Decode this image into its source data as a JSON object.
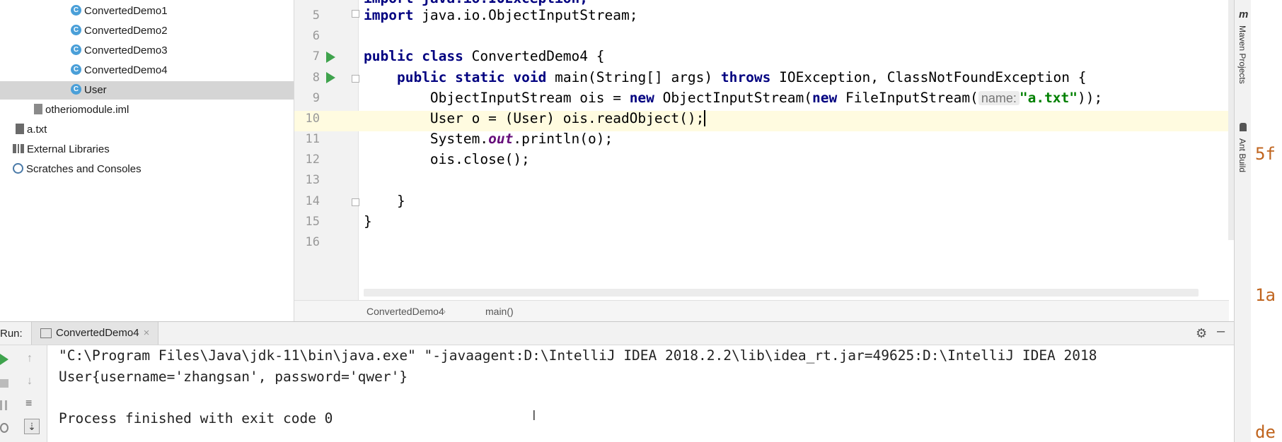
{
  "project_tree": {
    "items": [
      {
        "label": "ConvertedDemo1",
        "icon": "class-icon"
      },
      {
        "label": "ConvertedDemo2",
        "icon": "class-icon"
      },
      {
        "label": "ConvertedDemo3",
        "icon": "class-icon"
      },
      {
        "label": "ConvertedDemo4",
        "icon": "class-icon"
      },
      {
        "label": "User",
        "icon": "class-icon",
        "selected": true
      },
      {
        "label": "otheriomodule.iml",
        "icon": "iml-file-icon"
      },
      {
        "label": "a.txt",
        "icon": "text-file-icon"
      },
      {
        "label": "External Libraries",
        "icon": "library-icon"
      },
      {
        "label": "Scratches and Consoles",
        "icon": "scratch-icon"
      }
    ]
  },
  "editor": {
    "line_numbers": [
      "5",
      "6",
      "7",
      "8",
      "9",
      "10",
      "11",
      "12",
      "13",
      "14",
      "15",
      "16"
    ],
    "line4_partial": "import java.io.IOException;",
    "line5": {
      "kw": "import",
      "rest": " java.io.ObjectInputStream;"
    },
    "line7": {
      "kw1": "public",
      "kw2": "class",
      "rest": " ConvertedDemo4 {"
    },
    "line8": {
      "kw1": "public",
      "kw2": "static",
      "kw3": "void",
      "mid": " main(String[] args) ",
      "kw4": "throws",
      "rest": " IOException, ClassNotFoundException {"
    },
    "line9": {
      "a": "ObjectInputStream ois = ",
      "kw1": "new",
      "b": " ObjectInputStream(",
      "kw2": "new",
      "c": " FileInputStream(",
      "hint": "name:",
      "str": "\"a.txt\"",
      "d": "));"
    },
    "line10": "User o = (User) ois.readObject();",
    "line11": {
      "a": "System.",
      "field": "out",
      "b": ".println(o);"
    },
    "line12": "ois.close();",
    "line14": "}",
    "line15": "}",
    "breadcrumb": [
      "ConvertedDemo4",
      "main()"
    ]
  },
  "right_sidebar": {
    "maven_label": "Maven Projects",
    "ant_label": "Ant Build",
    "maven_glyph": "m"
  },
  "outside_text": [
    "5f",
    "1a",
    "de"
  ],
  "run_panel": {
    "run_label": "Run:",
    "tab_label": "ConvertedDemo4",
    "output": [
      "\"C:\\Program Files\\Java\\jdk-11\\bin\\java.exe\" \"-javaagent:D:\\IntelliJ IDEA 2018.2.2\\lib\\idea_rt.jar=49625:D:\\IntelliJ IDEA 2018",
      "User{username='zhangsan', password='qwer'}",
      "",
      "Process finished with exit code 0"
    ]
  },
  "colors": {
    "keyword": "#000080",
    "string": "#008000",
    "run_green": "#3fa34d",
    "class_icon": "#4a9fd8",
    "current_line": "#fffbe0"
  }
}
